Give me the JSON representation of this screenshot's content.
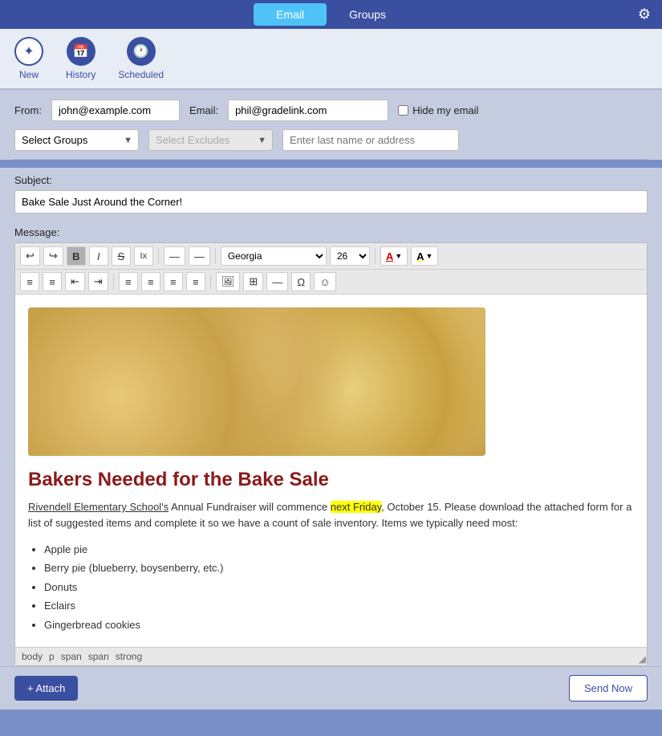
{
  "topNav": {
    "tabs": [
      {
        "id": "email",
        "label": "Email",
        "active": true
      },
      {
        "id": "groups",
        "label": "Groups",
        "active": false
      }
    ],
    "gear_label": "⚙"
  },
  "toolbar": {
    "items": [
      {
        "id": "new",
        "label": "New",
        "icon": "✦"
      },
      {
        "id": "history",
        "label": "History",
        "icon": "📅"
      },
      {
        "id": "scheduled",
        "label": "Scheduled",
        "icon": "🕐"
      }
    ]
  },
  "form": {
    "from_label": "From:",
    "from_value": "john@example.com",
    "email_label": "Email:",
    "email_value": "phil@gradelink.com",
    "hide_email_label": "Hide my email",
    "groups_placeholder": "Select Groups",
    "excludes_placeholder": "Select Excludes",
    "address_placeholder": "Enter last name or address"
  },
  "subject": {
    "label": "Subject:",
    "value": "Bake Sale Just Around the Corner!"
  },
  "message": {
    "label": "Message:"
  },
  "editor": {
    "toolbar": {
      "undo": "↩",
      "redo": "↪",
      "bold": "B",
      "italic": "I",
      "strikethrough": "S",
      "plain": "Ix",
      "link": "🔗",
      "unlink": "🔗",
      "font": "Georgia",
      "font_size": "26",
      "font_color_label": "A",
      "bg_color_label": "A",
      "ol": "≡",
      "ul": "≡",
      "indent_less": "⇤",
      "indent_more": "⇥",
      "align_left": "≡",
      "align_center": "≡",
      "align_right": "≡",
      "align_justify": "≡",
      "image": "🖼",
      "table": "⊞",
      "hr": "—",
      "special": "Ω",
      "emoji": "☺",
      "resize": "◢"
    },
    "content": {
      "heading": "Bakers Needed for the Bake Sale",
      "paragraph": "Rivendell Elementary School's Annual Fundraiser will commence next Friday, October 15. Please download the attached form for a list of suggested items and complete it so we have a count of sale inventory. Items we typically need most:",
      "highlight_text": "next Friday",
      "list_items": [
        "Apple pie",
        "Berry pie (blueberry, boysenberry, etc.)",
        "Donuts",
        "Eclairs",
        "Gingerbread cookies"
      ],
      "link_text": "Rivendell Elementary School's"
    }
  },
  "statusBar": {
    "tags": [
      "body",
      "p",
      "span",
      "span",
      "strong"
    ]
  },
  "bottom": {
    "attach_label": "+ Attach",
    "send_label": "Send Now"
  }
}
